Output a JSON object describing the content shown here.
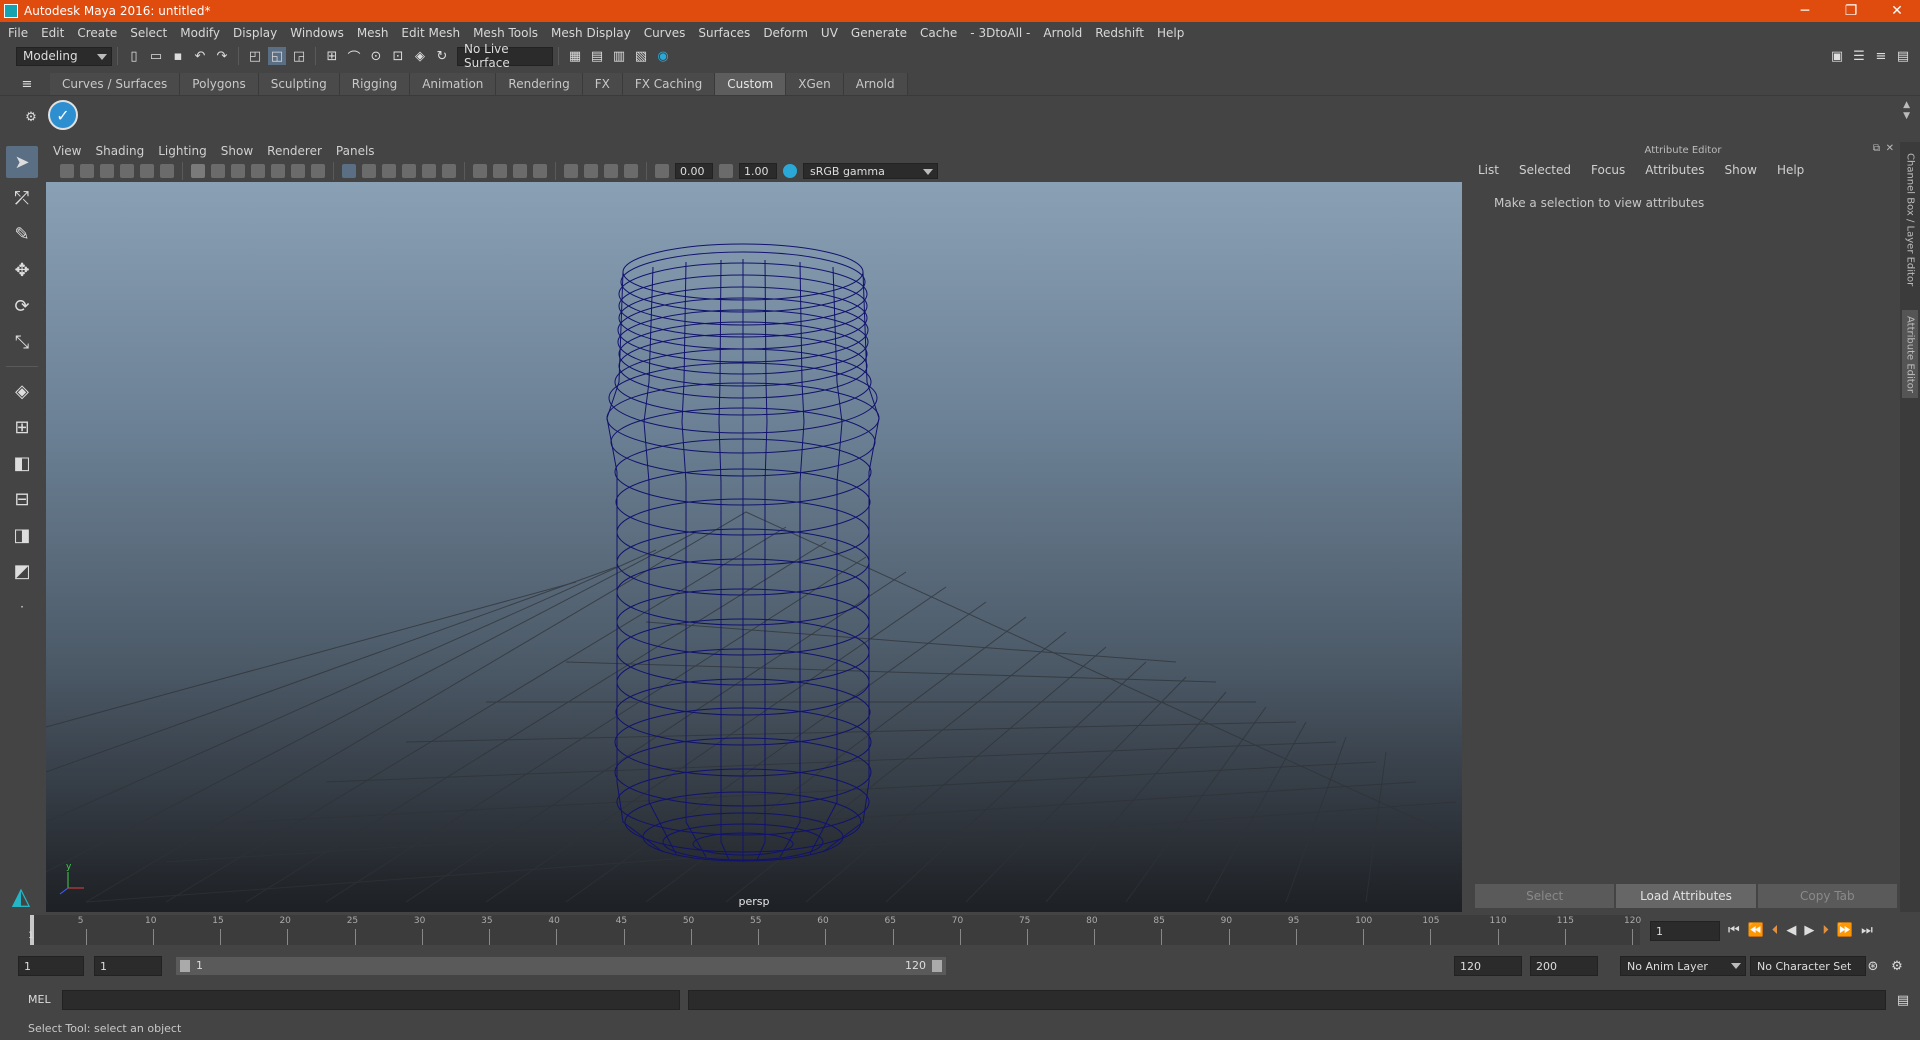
{
  "window": {
    "title": "Autodesk Maya 2016: untitled*",
    "minimize": "─",
    "restore": "❐",
    "close": "✕"
  },
  "menubar": [
    "File",
    "Edit",
    "Create",
    "Select",
    "Modify",
    "Display",
    "Windows",
    "Mesh",
    "Edit Mesh",
    "Mesh Tools",
    "Mesh Display",
    "Curves",
    "Surfaces",
    "Deform",
    "UV",
    "Generate",
    "Cache",
    "- 3DtoAll -",
    "Arnold",
    "Redshift",
    "Help"
  ],
  "statusline": {
    "mode": "Modeling",
    "live_surface": "No Live Surface"
  },
  "shelf_tabs": [
    "Curves / Surfaces",
    "Polygons",
    "Sculpting",
    "Rigging",
    "Animation",
    "Rendering",
    "FX",
    "FX Caching",
    "Custom",
    "XGen",
    "Arnold"
  ],
  "shelf_active": "Custom",
  "panel_menu": [
    "View",
    "Shading",
    "Lighting",
    "Show",
    "Renderer",
    "Panels"
  ],
  "panel_toolbar": {
    "exposure": "0.00",
    "gamma": "1.00",
    "color_space": "sRGB gamma"
  },
  "viewport": {
    "camera": "persp"
  },
  "attribute_editor": {
    "header": "Attribute Editor",
    "menu": [
      "List",
      "Selected",
      "Focus",
      "Attributes",
      "Show",
      "Help"
    ],
    "message": "Make a selection to view attributes",
    "buttons": {
      "select": "Select",
      "load": "Load Attributes",
      "copy": "Copy Tab"
    }
  },
  "side_tabs": {
    "channel_box": "Channel Box / Layer Editor",
    "attribute_editor": "Attribute Editor"
  },
  "timeline": {
    "ticks": [
      "5",
      "10",
      "15",
      "20",
      "25",
      "30",
      "35",
      "40",
      "45",
      "50",
      "55",
      "60",
      "65",
      "70",
      "75",
      "80",
      "85",
      "90",
      "95",
      "100",
      "105",
      "110",
      "115",
      "120"
    ],
    "start_tick": "1",
    "current_frame": "1"
  },
  "range": {
    "start": "1",
    "playback_start": "1",
    "slider_start": "1",
    "slider_end": "120",
    "playback_end": "120",
    "end": "200",
    "anim_layer": "No Anim Layer",
    "character_set": "No Character Set"
  },
  "command_line": {
    "label": "MEL"
  },
  "help_line": "Select Tool: select an object"
}
